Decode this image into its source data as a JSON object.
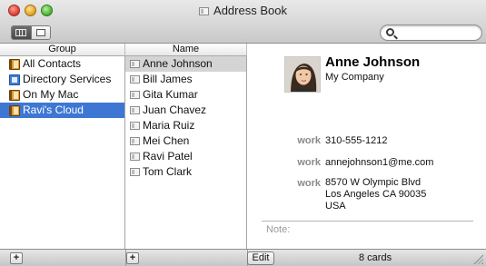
{
  "window": {
    "title": "Address Book"
  },
  "toolbar": {
    "view_buttons": [
      {
        "name": "column-view",
        "icon": "columns-icon",
        "active": true
      },
      {
        "name": "card-view",
        "icon": "card-icon",
        "active": false
      }
    ],
    "search": {
      "value": "",
      "placeholder": ""
    }
  },
  "groups": {
    "header": "Group",
    "items": [
      {
        "label": "All Contacts",
        "icon": "address-book-icon"
      },
      {
        "label": "Directory Services",
        "icon": "directory-icon"
      },
      {
        "label": "On My Mac",
        "icon": "address-book-icon"
      },
      {
        "label": "Ravi's Cloud",
        "icon": "address-book-icon",
        "selected": true
      }
    ]
  },
  "names": {
    "header": "Name",
    "items": [
      {
        "label": "Anne Johnson",
        "selected": true
      },
      {
        "label": "Bill James"
      },
      {
        "label": "Gita Kumar"
      },
      {
        "label": "Juan Chavez"
      },
      {
        "label": "Maria Ruiz"
      },
      {
        "label": "Mei Chen"
      },
      {
        "label": "Ravi Patel"
      },
      {
        "label": "Tom Clark"
      }
    ]
  },
  "card": {
    "name": "Anne Johnson",
    "company": "My Company",
    "phone": {
      "label": "work",
      "value": "310-555-1212"
    },
    "email": {
      "label": "work",
      "value": "annejohnson1@me.com"
    },
    "address": {
      "label": "work",
      "line1": "8570 W Olympic Blvd",
      "line2": "Los Angeles CA 90035",
      "line3": "USA"
    },
    "note_label": "Note:"
  },
  "bottombar": {
    "add_group": "+",
    "add_contact": "+",
    "edit_label": "Edit",
    "card_count": "8 cards"
  },
  "colors": {
    "selection_blue": "#3e77d3",
    "selection_gray": "#d4d4d4",
    "label_gray": "#8a8a8a"
  }
}
